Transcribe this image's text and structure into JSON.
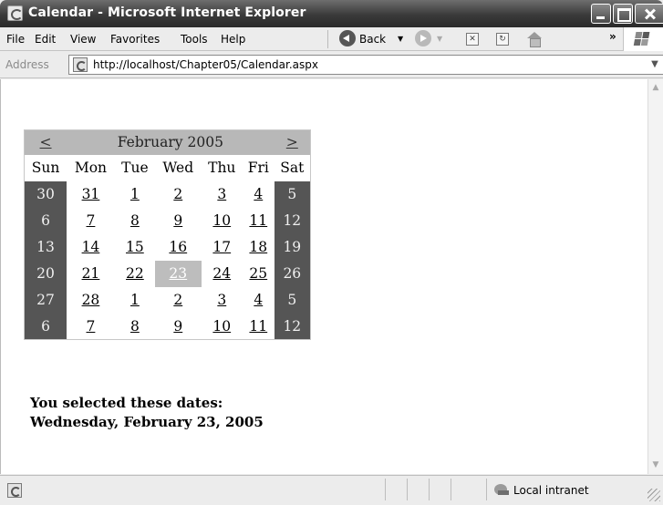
{
  "window": {
    "title": "Calendar - Microsoft Internet Explorer"
  },
  "menu": {
    "items": [
      "File",
      "Edit",
      "View",
      "Favorites",
      "Tools",
      "Help"
    ]
  },
  "toolbar": {
    "back_label": "Back",
    "overflow": "»"
  },
  "address": {
    "label": "Address",
    "url": "http://localhost/Chapter05/Calendar.aspx"
  },
  "calendar": {
    "prev_label": "<",
    "next_label": ">",
    "month_title": "February 2005",
    "day_headers": [
      "Sun",
      "Mon",
      "Tue",
      "Wed",
      "Thu",
      "Fri",
      "Sat"
    ],
    "weeks": [
      [
        "30",
        "31",
        "1",
        "2",
        "3",
        "4",
        "5"
      ],
      [
        "6",
        "7",
        "8",
        "9",
        "10",
        "11",
        "12"
      ],
      [
        "13",
        "14",
        "15",
        "16",
        "17",
        "18",
        "19"
      ],
      [
        "20",
        "21",
        "22",
        "23",
        "24",
        "25",
        "26"
      ],
      [
        "27",
        "28",
        "1",
        "2",
        "3",
        "4",
        "5"
      ],
      [
        "6",
        "7",
        "8",
        "9",
        "10",
        "11",
        "12"
      ]
    ],
    "selected_date": "23"
  },
  "selection": {
    "heading": "You selected these dates:",
    "date": "Wednesday, February 23, 2005"
  },
  "status": {
    "zone": "Local intranet"
  },
  "colors": {
    "weekend_bg": "#555555",
    "title_bg": "#b8b8b8",
    "selected_bg": "#bdbdbd"
  }
}
